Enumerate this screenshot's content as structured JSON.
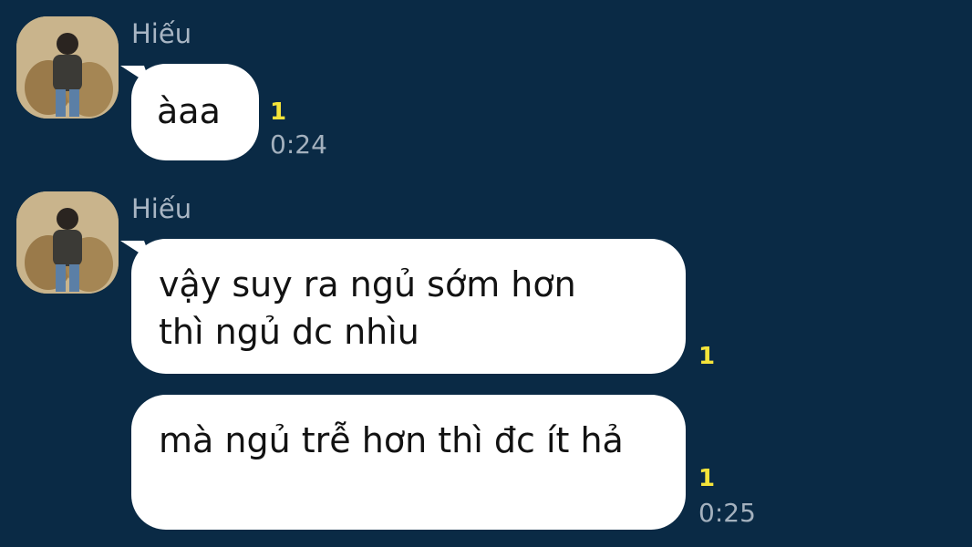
{
  "messages": [
    {
      "sender": "Hiếu",
      "bubbles": [
        {
          "text": "àaa",
          "read_count": "1",
          "time": "0:24"
        }
      ]
    },
    {
      "sender": "Hiếu",
      "bubbles": [
        {
          "text": "vậy suy ra ngủ sớm hơn thì ngủ dc nhìu",
          "read_count": "1",
          "time": ""
        },
        {
          "text": "mà ngủ trễ hơn thì đc ít hả",
          "read_count": "1",
          "time": "0:25"
        }
      ]
    }
  ],
  "colors": {
    "background": "#0a2a45",
    "bubble": "#ffffff",
    "read_count": "#f5e43a",
    "sender_name": "#a9b6c4"
  }
}
